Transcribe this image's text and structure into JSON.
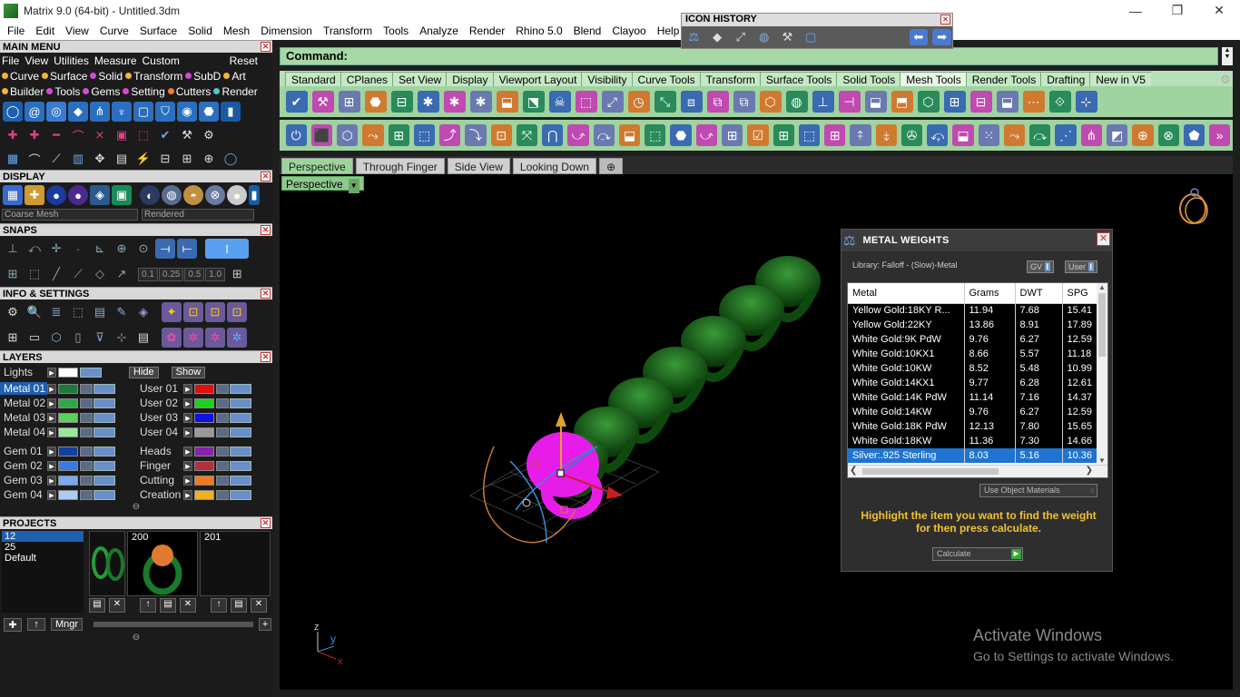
{
  "window": {
    "title": "Matrix 9.0 (64-bit) - Untitled.3dm"
  },
  "menubar": [
    "File",
    "Edit",
    "View",
    "Curve",
    "Surface",
    "Solid",
    "Mesh",
    "Dimension",
    "Transform",
    "Tools",
    "Analyze",
    "Render",
    "Rhino 5.0",
    "Blend",
    "Clayoo",
    "Help"
  ],
  "icon_history": {
    "title": "ICON HISTORY"
  },
  "main_menu": {
    "title": "MAIN MENU",
    "row1": [
      "File",
      "View",
      "Utilities",
      "Measure",
      "Custom"
    ],
    "reset": "Reset",
    "row2": [
      {
        "label": "Curve",
        "color": "#f2b630"
      },
      {
        "label": "Surface",
        "color": "#f2b630"
      },
      {
        "label": "Solid",
        "color": "#d24ad2"
      },
      {
        "label": "Transform",
        "color": "#f2b630"
      },
      {
        "label": "SubD",
        "color": "#d24ad2"
      },
      {
        "label": "Art",
        "color": "#f2b630"
      }
    ],
    "row3": [
      {
        "label": "Builder",
        "color": "#f2b630"
      },
      {
        "label": "Tools",
        "color": "#d24ad2"
      },
      {
        "label": "Gems",
        "color": "#d24ad2"
      },
      {
        "label": "Setting",
        "color": "#d24ad2"
      },
      {
        "label": "Cutters",
        "color": "#f27a30"
      },
      {
        "label": "Render",
        "color": "#4ac8d2"
      }
    ]
  },
  "display": {
    "title": "DISPLAY",
    "mesh": "Coarse Mesh",
    "mode": "Rendered"
  },
  "snaps": {
    "title": "SNAPS",
    "values": [
      "0.1",
      "0.25",
      "0.5",
      "1.0"
    ]
  },
  "info": {
    "title": "INFO & SETTINGS"
  },
  "layers": {
    "title": "LAYERS",
    "lights": "Lights",
    "hide": "Hide",
    "show": "Show",
    "left": [
      {
        "name": "Metal 01",
        "color": "#1a7a3a",
        "sel": true
      },
      {
        "name": "Metal 02",
        "color": "#2fa84a"
      },
      {
        "name": "Metal 03",
        "color": "#5cd05c"
      },
      {
        "name": "Metal 04",
        "color": "#9be89b"
      },
      {
        "name": "Gem 01",
        "color": "#1040a0"
      },
      {
        "name": "Gem 02",
        "color": "#3a7ae0"
      },
      {
        "name": "Gem 03",
        "color": "#7aaaf0"
      },
      {
        "name": "Gem 04",
        "color": "#aaccf5"
      }
    ],
    "right": [
      {
        "name": "User 01",
        "color": "#e01010"
      },
      {
        "name": "User 02",
        "color": "#20d020"
      },
      {
        "name": "User 03",
        "color": "#1010e0"
      },
      {
        "name": "User 04",
        "color": "#9a9a9a"
      },
      {
        "name": "Heads",
        "color": "#8a20b0"
      },
      {
        "name": "Finger",
        "color": "#b03040"
      },
      {
        "name": "Cutting",
        "color": "#f07a20"
      },
      {
        "name": "Creation",
        "color": "#f0b020"
      }
    ]
  },
  "projects": {
    "title": "PROJECTS",
    "list": [
      "12",
      "25",
      "Default"
    ],
    "thumbs": [
      "",
      "200",
      "201"
    ],
    "mngr": "Mngr"
  },
  "command": {
    "label": "Command:"
  },
  "toolbar_tabs": [
    "Standard",
    "CPlanes",
    "Set View",
    "Display",
    "Viewport Layout",
    "Visibility",
    "Curve Tools",
    "Transform",
    "Surface Tools",
    "Solid Tools",
    "Mesh Tools",
    "Render Tools",
    "Drafting",
    "New in V5"
  ],
  "active_toolbar_tab": "Mesh Tools",
  "viewport_tabs": [
    "Perspective",
    "Through Finger",
    "Side View",
    "Looking Down"
  ],
  "viewport": {
    "label": "Perspective"
  },
  "metal_weights": {
    "title": "METAL WEIGHTS",
    "library": "Library: Falloff - (Slow)-Metal",
    "gv": "GV",
    "user": "User",
    "columns": [
      "Metal",
      "Grams",
      "DWT",
      "SPG"
    ],
    "rows": [
      [
        "Yellow Gold:18KY R...",
        "11.94",
        "7.68",
        "15.41"
      ],
      [
        "Yellow Gold:22KY",
        "13.86",
        "8.91",
        "17.89"
      ],
      [
        "White Gold:9K PdW",
        "9.76",
        "6.27",
        "12.59"
      ],
      [
        "White Gold:10KX1",
        "8.66",
        "5.57",
        "11.18"
      ],
      [
        "White Gold:10KW",
        "8.52",
        "5.48",
        "10.99"
      ],
      [
        "White Gold:14KX1",
        "9.77",
        "6.28",
        "12.61"
      ],
      [
        "White Gold:14K PdW",
        "11.14",
        "7.16",
        "14.37"
      ],
      [
        "White Gold:14KW",
        "9.76",
        "6.27",
        "12.59"
      ],
      [
        "White Gold:18K PdW",
        "12.13",
        "7.80",
        "15.65"
      ],
      [
        "White Gold:18KW",
        "11.36",
        "7.30",
        "14.66"
      ],
      [
        "Silver:.925 Sterling",
        "8.03",
        "5.16",
        "10.36"
      ]
    ],
    "selected_row": 10,
    "use_object": "Use Object Materials",
    "hint": "Highlight the item you want to find the weight for then press calculate.",
    "calculate": "Calculate"
  },
  "watermark": {
    "line1": "Activate Windows",
    "line2": "Go to Settings to activate Windows."
  },
  "axis": {
    "z": "z",
    "y": "y",
    "x": "x"
  }
}
